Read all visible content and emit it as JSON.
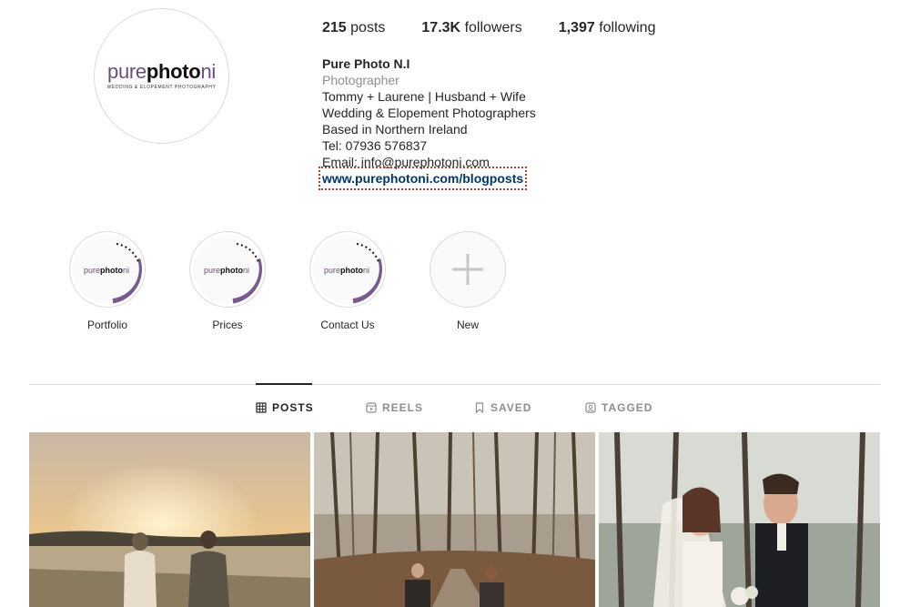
{
  "profile": {
    "logo": {
      "pure": "pure",
      "photo": "photo",
      "ni": "ni",
      "tagline": "WEDDING & ELOPEMENT PHOTOGRAPHY"
    }
  },
  "stats": {
    "posts_count": "215",
    "posts_label": "posts",
    "followers_count": "17.3K",
    "followers_label": "followers",
    "following_count": "1,397",
    "following_label": "following"
  },
  "bio": {
    "name": "Pure Photo N.I",
    "category": "Photographer",
    "lines": [
      "Tommy + Laurene | Husband + Wife",
      "Wedding & Elopement Photographers",
      "Based in Northern Ireland",
      "Tel: 07936 576837",
      "Email: info@purephotoni.com"
    ],
    "link": "www.purephotoni.com/blogposts"
  },
  "highlights": [
    {
      "label": "Portfolio"
    },
    {
      "label": "Prices"
    },
    {
      "label": "Contact Us"
    },
    {
      "label": "New",
      "icon": "plus-icon"
    }
  ],
  "tabs": [
    {
      "label": "POSTS",
      "icon": "grid-icon",
      "active": true
    },
    {
      "label": "REELS",
      "icon": "reels-icon",
      "active": false
    },
    {
      "label": "SAVED",
      "icon": "bookmark-icon",
      "active": false
    },
    {
      "label": "TAGGED",
      "icon": "tagged-icon",
      "active": false
    }
  ],
  "colors": {
    "brand_purple": "#6b4f7a",
    "link": "#00376b",
    "muted": "#8e8e8e",
    "border": "#dbdbdb"
  }
}
